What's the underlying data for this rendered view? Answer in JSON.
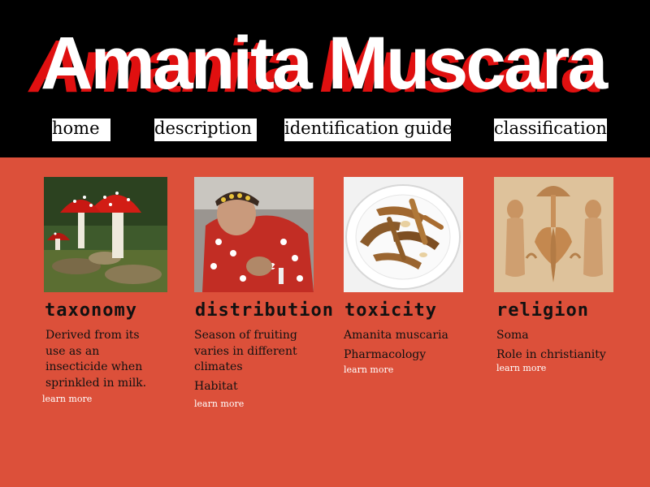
{
  "site": {
    "title": "Amanita Muscara"
  },
  "nav": [
    {
      "label": "home"
    },
    {
      "label": "description"
    },
    {
      "label": "identification guide"
    },
    {
      "label": "classification"
    }
  ],
  "cards": [
    {
      "heading": "taxonomy",
      "lines": [
        "Derived from its use as an insecticide when sprinkled in milk."
      ],
      "link": "learn more"
    },
    {
      "heading": "distribution",
      "lines": [
        "Season of fruiting varies in different climates",
        "Habitat"
      ],
      "link": "learn more"
    },
    {
      "heading": "toxicity",
      "lines": [
        "Amanita muscaria",
        "Pharmacology"
      ],
      "link": "learn more"
    },
    {
      "heading": "religion",
      "lines": [
        "Soma",
        "Role in christianity"
      ],
      "link": "learn more"
    }
  ],
  "colors": {
    "header_bg": "#000000",
    "body_bg": "#dc503a",
    "title_shadow": "#e01010"
  }
}
